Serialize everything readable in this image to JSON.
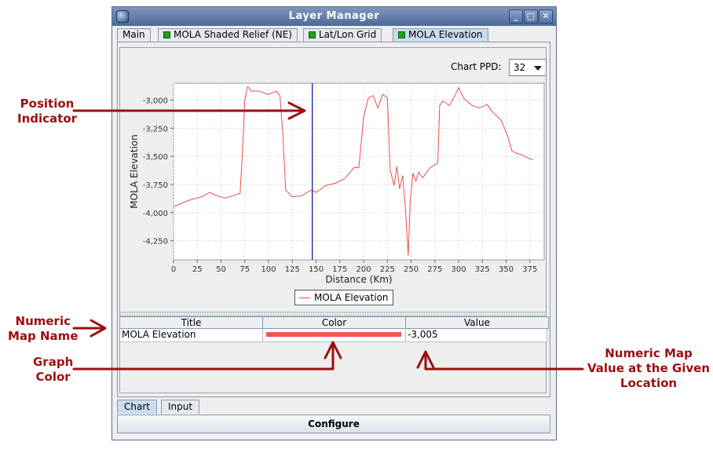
{
  "window": {
    "title": "Layer Manager",
    "buttons": {
      "minimize": "_",
      "maximize": "□",
      "close": "✕"
    }
  },
  "tabs": [
    {
      "label": "Main",
      "icon": null,
      "active": false
    },
    {
      "label": "MOLA Shaded Relief (NE)",
      "icon": "green-square-icon",
      "active": false
    },
    {
      "label": "Lat/Lon Grid",
      "icon": "green-square-icon",
      "active": false
    },
    {
      "label": "MOLA Elevation",
      "icon": "green-square-icon",
      "active": true
    }
  ],
  "controls": {
    "ppd_label": "Chart PPD:",
    "ppd_value": "32"
  },
  "chart_data": {
    "type": "line",
    "xlabel": "Distance (Km)",
    "ylabel": "MOLA Elevation",
    "xlim": [
      0,
      390
    ],
    "ylim": [
      -4420,
      -2850
    ],
    "x_ticks": [
      0,
      25,
      50,
      75,
      100,
      125,
      150,
      175,
      200,
      225,
      250,
      275,
      300,
      325,
      350,
      375
    ],
    "y_ticks": [
      -3000,
      -3250,
      -3500,
      -3750,
      -4000,
      -4250
    ],
    "y_tick_labels": [
      "-3,000",
      "-3,250",
      "-3,500",
      "-3,750",
      "-4,000",
      "-4,250"
    ],
    "grid": true,
    "legend": "bottom-center",
    "position_indicator_x": 146,
    "series": [
      {
        "name": "MOLA Elevation",
        "color": "#e94e4e",
        "x": [
          0,
          10,
          20,
          30,
          38,
          45,
          55,
          62,
          70,
          72,
          75,
          78,
          82,
          90,
          100,
          108,
          112,
          115,
          118,
          125,
          135,
          145,
          150,
          160,
          170,
          180,
          190,
          195,
          200,
          205,
          210,
          215,
          220,
          225,
          228,
          232,
          235,
          238,
          241,
          244,
          247,
          249,
          252,
          255,
          258,
          262,
          270,
          278,
          280,
          283,
          286,
          290,
          296,
          300,
          305,
          310,
          315,
          322,
          330,
          335,
          345,
          352,
          356,
          360,
          368,
          372,
          375,
          378
        ],
        "y": [
          -3950,
          -3910,
          -3880,
          -3860,
          -3820,
          -3850,
          -3870,
          -3850,
          -3830,
          -3550,
          -3000,
          -2880,
          -2920,
          -2920,
          -2950,
          -2920,
          -2960,
          -3300,
          -3800,
          -3860,
          -3850,
          -3800,
          -3820,
          -3760,
          -3740,
          -3700,
          -3600,
          -3600,
          -3150,
          -2980,
          -2960,
          -3070,
          -2950,
          -2980,
          -3620,
          -3760,
          -3590,
          -3790,
          -3670,
          -3960,
          -4380,
          -3890,
          -3650,
          -3720,
          -3640,
          -3690,
          -3600,
          -3560,
          -3050,
          -3010,
          -3020,
          -3050,
          -2960,
          -2890,
          -2980,
          -3020,
          -3050,
          -3070,
          -3040,
          -3100,
          -3180,
          -3330,
          -3450,
          -3470,
          -3490,
          -3510,
          -3520,
          -3530
        ]
      }
    ]
  },
  "table": {
    "headers": [
      "Title",
      "Color",
      "Value"
    ],
    "rows": [
      {
        "title": "MOLA Elevation",
        "color": "#f25656",
        "value": "-3,005"
      }
    ]
  },
  "subtabs": [
    {
      "label": "Chart",
      "active": true
    },
    {
      "label": "Input",
      "active": false
    }
  ],
  "configure_label": "Configure",
  "annotations": {
    "position_indicator": [
      "Position",
      "Indicator"
    ],
    "numeric_map_name": [
      "Numeric",
      "Map Name"
    ],
    "graph_color": [
      "Graph",
      "Color"
    ],
    "numeric_map_value": [
      "Numeric Map",
      "Value at the Given",
      "Location"
    ],
    "color": "#9b0f0f"
  }
}
